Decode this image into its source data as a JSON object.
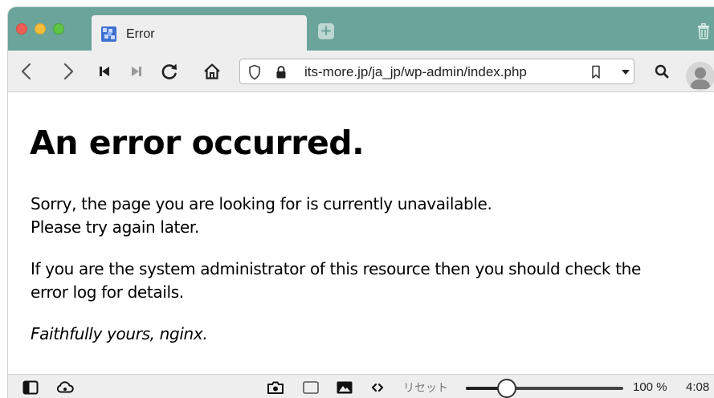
{
  "browser": {
    "tab": {
      "title": "Error",
      "favicon": "site-favicon"
    },
    "new_tab_icon": "plus-icon",
    "trash_icon": "trash-icon",
    "toolbar": {
      "icons": [
        "back-icon",
        "forward-icon",
        "rewind-icon",
        "fast-forward-icon",
        "reload-icon",
        "home-icon"
      ],
      "address": "its-more.jp/ja_jp/wp-admin/index.php",
      "shield_icon": "shield-icon",
      "lock_icon": "lock-icon",
      "bookmark_icon": "bookmark-icon",
      "dropdown_icon": "chevron-down-icon",
      "search_icon": "search-icon",
      "profile_icon": "avatar"
    },
    "colors": {
      "tabbar": "#6aa49a",
      "chrome": "#eeeeee"
    }
  },
  "page": {
    "heading": "An error occurred.",
    "paragraph1_line1": "Sorry, the page you are looking for is currently unavailable.",
    "paragraph1_line2": "Please try again later.",
    "paragraph2_line1": "If you are the system administrator of this resource then you should check the",
    "paragraph2_line2": "error log for details.",
    "signature": "Faithfully yours, nginx."
  },
  "statusbar": {
    "reset_label": "リセット",
    "zoom_label": "100 %",
    "zoom_level_percent": 100,
    "clock": "4:08"
  }
}
